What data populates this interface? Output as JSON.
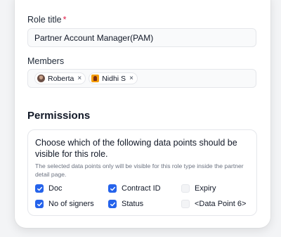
{
  "role": {
    "label": "Role title",
    "required_mark": "*",
    "value": "Partner Account Manager(PAM)"
  },
  "members": {
    "label": "Members",
    "chips": [
      {
        "name": "Roberta",
        "remove": "×"
      },
      {
        "name": "Nidhi S",
        "remove": "×"
      }
    ]
  },
  "permissions": {
    "title": "Permissions",
    "heading": "Choose which of the following data points should be visible for this role.",
    "note": "The selected data points only will be visible for this role type inside the partner detail page.",
    "options": [
      {
        "label": "Doc",
        "checked": true
      },
      {
        "label": "Contract ID",
        "checked": true
      },
      {
        "label": "Expiry",
        "checked": false
      },
      {
        "label": "No of signers",
        "checked": true
      },
      {
        "label": "Status",
        "checked": true
      },
      {
        "label": "<Data Point 6>",
        "checked": false
      }
    ]
  },
  "colors": {
    "accent": "#2563eb",
    "required": "#e11d48"
  }
}
